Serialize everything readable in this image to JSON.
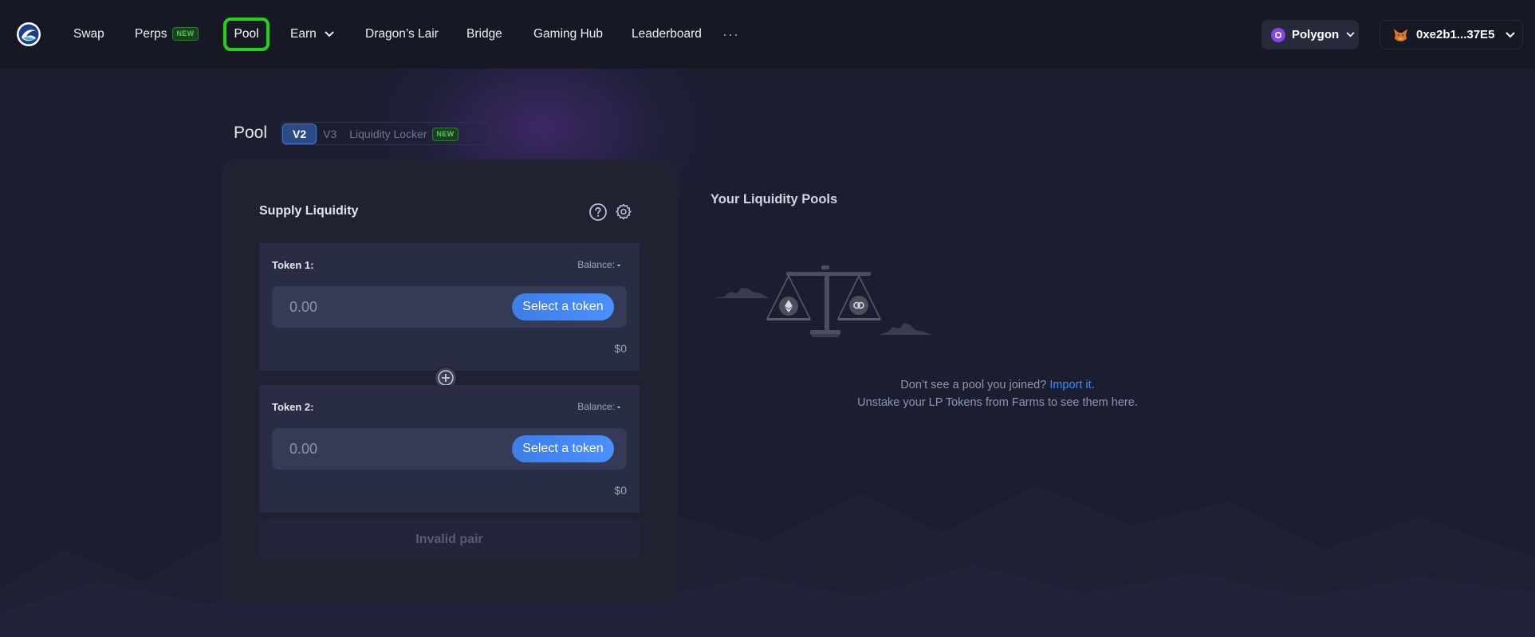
{
  "nav": {
    "items": [
      "Swap",
      "Perps",
      "Pool",
      "Earn",
      "Dragon’s Lair",
      "Bridge",
      "Gaming Hub",
      "Leaderboard"
    ],
    "perps_badge": "NEW",
    "more": "···",
    "network": "Polygon",
    "wallet": "0xe2b1...37E5"
  },
  "pool": {
    "title": "Pool",
    "tabs": [
      "V2",
      "V3",
      "Liquidity Locker"
    ],
    "locker_badge": "NEW"
  },
  "supply": {
    "title": "Supply Liquidity",
    "token1": {
      "label": "Token 1:",
      "balance_label": "Balance:",
      "balance_value": "-",
      "placeholder": "0.00",
      "select_label": "Select a token",
      "usd": "$0"
    },
    "token2": {
      "label": "Token 2:",
      "balance_label": "Balance:",
      "balance_value": "-",
      "placeholder": "0.00",
      "select_label": "Select a token",
      "usd": "$0"
    },
    "action_label": "Invalid pair"
  },
  "liquidity": {
    "title": "Your Liquidity Pools",
    "empty_line1": "Don’t see a pool you joined?",
    "import_link": "Import it",
    "empty_line1_end": ".",
    "empty_line2": "Unstake your LP Tokens from Farms to see them here."
  },
  "colors": {
    "accent": "#3f8cff",
    "active_outline": "#21d21b",
    "new_badge": "#45d14a",
    "polygon": "#8247e5"
  }
}
